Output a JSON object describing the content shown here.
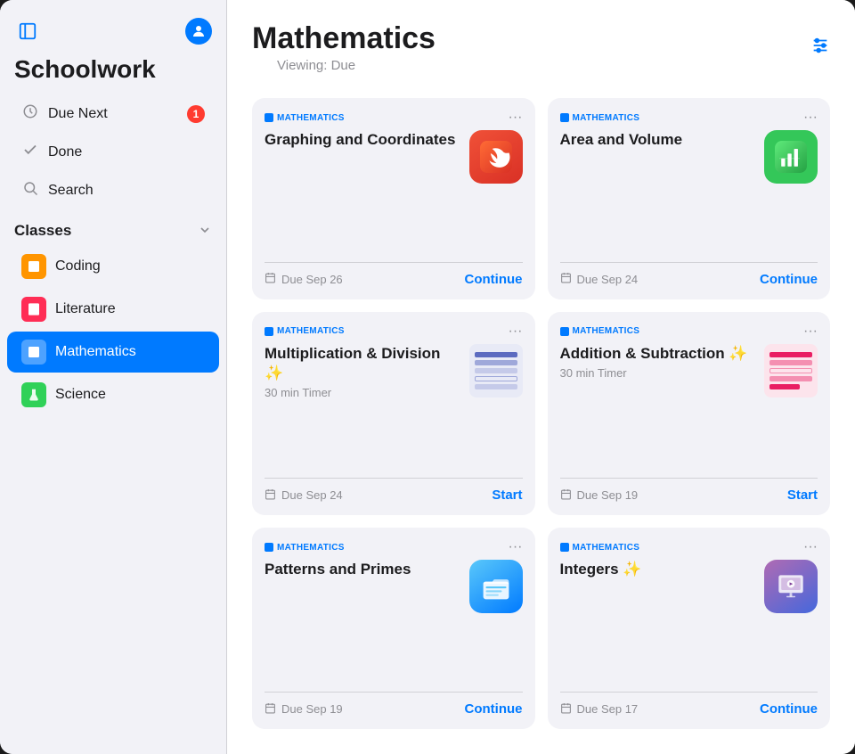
{
  "sidebar": {
    "title": "Schoolwork",
    "nav_items": [
      {
        "id": "due-next",
        "label": "Due Next",
        "icon": "clock",
        "badge": "1"
      },
      {
        "id": "done",
        "label": "Done",
        "icon": "check"
      },
      {
        "id": "search",
        "label": "Search",
        "icon": "magnifier"
      }
    ],
    "classes_section": {
      "label": "Classes",
      "items": [
        {
          "id": "coding",
          "label": "Coding",
          "icon_color": "#ff9500",
          "active": false
        },
        {
          "id": "literature",
          "label": "Literature",
          "icon_color": "#ff2d55",
          "active": false
        },
        {
          "id": "mathematics",
          "label": "Mathematics",
          "icon_color": "#007aff",
          "active": true
        },
        {
          "id": "science",
          "label": "Science",
          "icon_color": "#30d158",
          "active": false
        }
      ]
    }
  },
  "main": {
    "title": "Mathematics",
    "viewing_label": "Viewing: Due",
    "filter_icon": "sliders",
    "assignments": [
      {
        "id": "graphing",
        "subject": "Mathematics",
        "title": "Graphing and Coordinates",
        "subtitle": "",
        "due": "Due Sep 26",
        "action": "Continue",
        "icon_type": "swift"
      },
      {
        "id": "area-volume",
        "subject": "Mathematics",
        "title": "Area and Volume",
        "subtitle": "",
        "due": "Due Sep 24",
        "action": "Continue",
        "icon_type": "numbers"
      },
      {
        "id": "multiplication",
        "subject": "Mathematics",
        "title": "Multiplication & Division ✨",
        "subtitle": "30 min Timer",
        "due": "Due Sep 24",
        "action": "Start",
        "icon_type": "thumbnail"
      },
      {
        "id": "addition",
        "subject": "Mathematics",
        "title": "Addition & Subtraction ✨",
        "subtitle": "30 min Timer",
        "due": "Due Sep 19",
        "action": "Start",
        "icon_type": "thumbnail2"
      },
      {
        "id": "patterns",
        "subject": "Mathematics",
        "title": "Patterns and Primes",
        "subtitle": "",
        "due": "Due Sep 19",
        "action": "Continue",
        "icon_type": "files"
      },
      {
        "id": "integers",
        "subject": "Mathematics",
        "title": "Integers ✨",
        "subtitle": "",
        "due": "Due Sep 17",
        "action": "Continue",
        "icon_type": "keynote"
      }
    ]
  }
}
